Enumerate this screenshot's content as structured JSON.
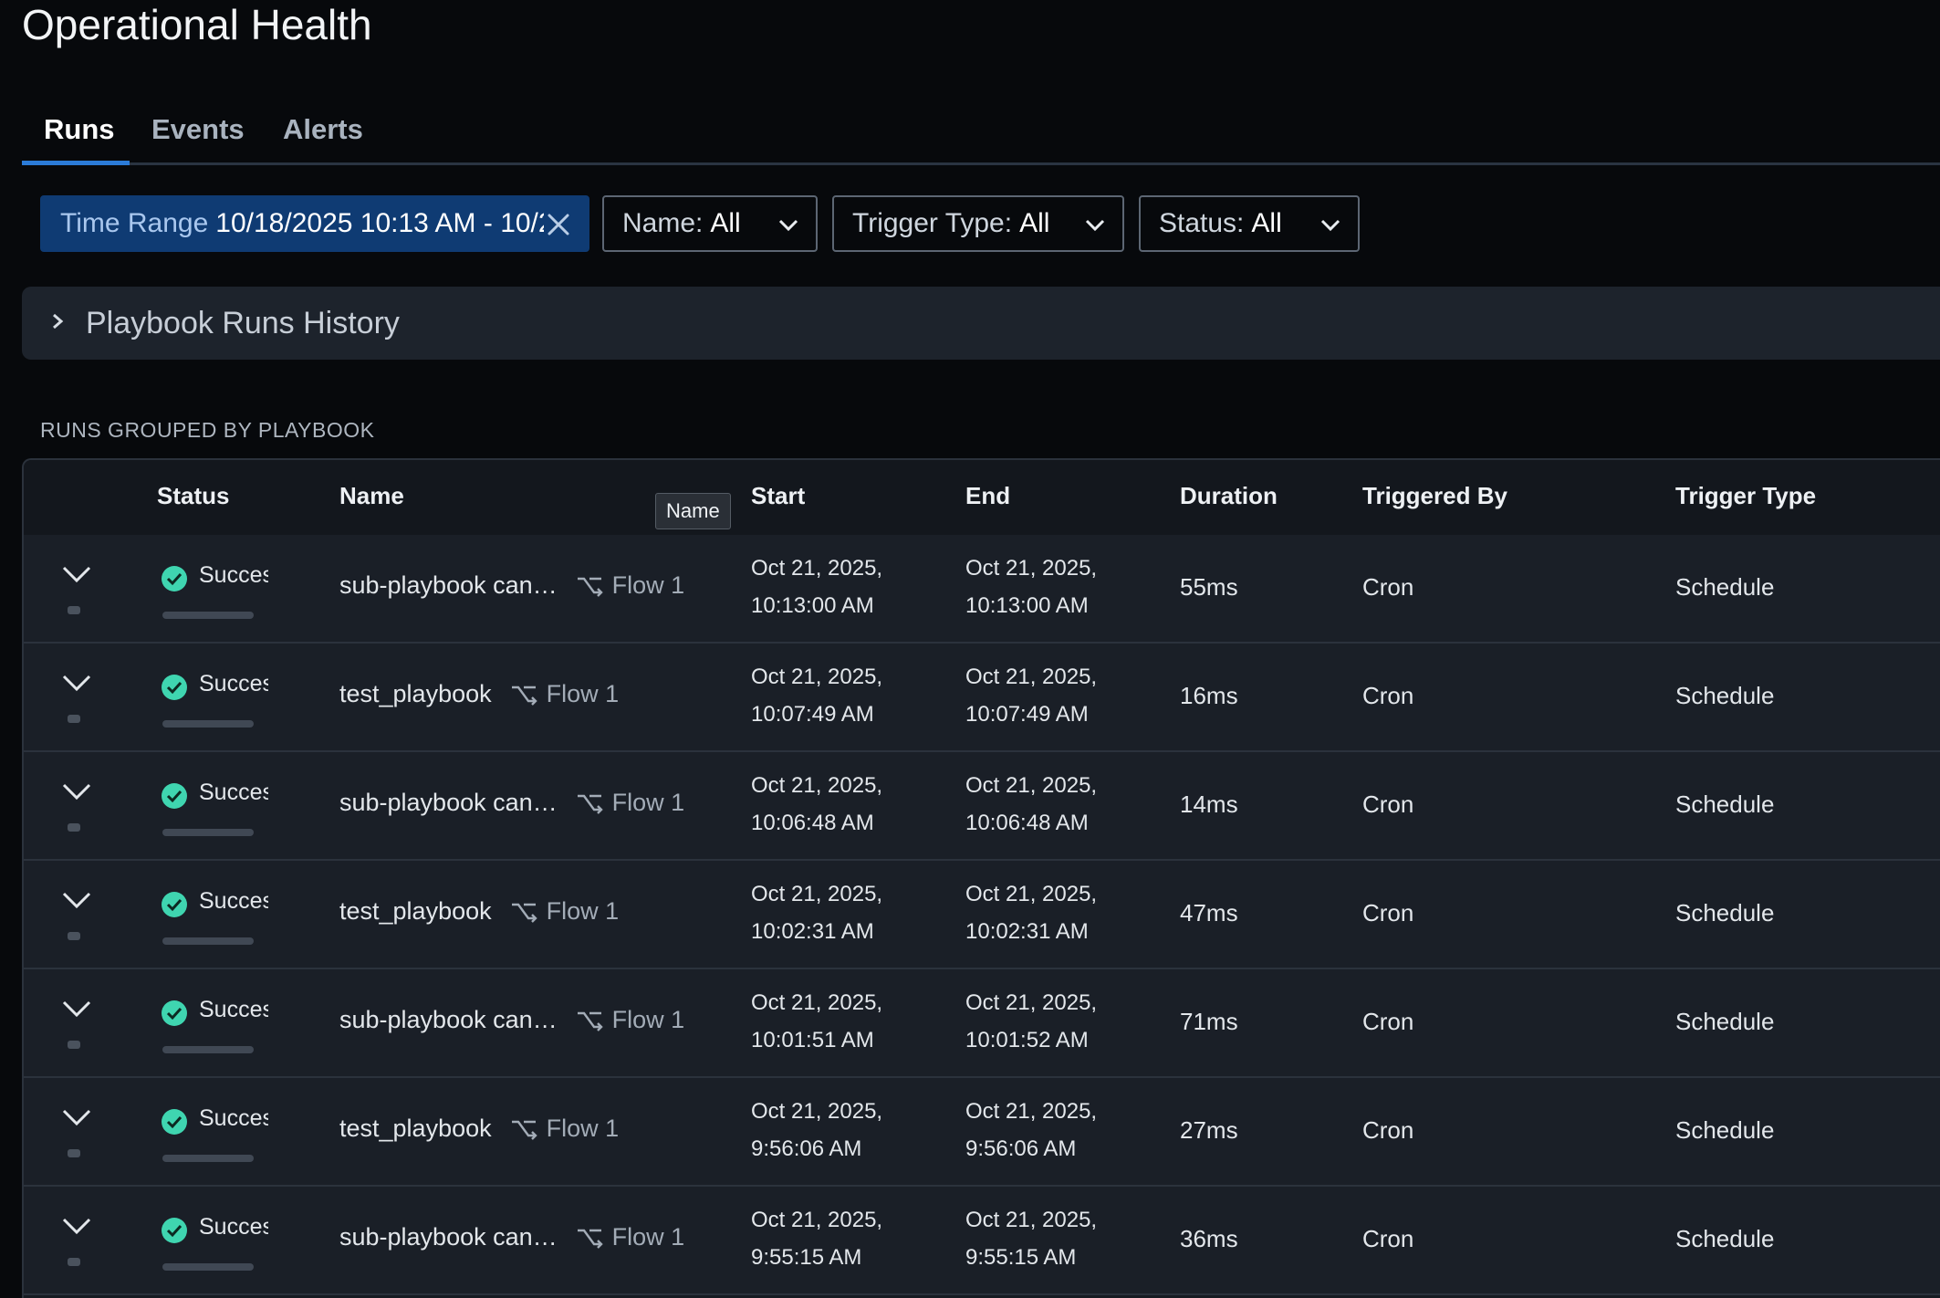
{
  "page": {
    "title": "Operational Health"
  },
  "tabs": [
    {
      "label": "Runs"
    },
    {
      "label": "Events"
    },
    {
      "label": "Alerts"
    }
  ],
  "filters": {
    "time_range": {
      "label": "Time Range",
      "value": "10/18/2025 10:13 AM - 10/2"
    },
    "name": {
      "label": "Name:",
      "value": "All"
    },
    "trigger_type": {
      "label": "Trigger Type:",
      "value": "All"
    },
    "status": {
      "label": "Status:",
      "value": "All"
    }
  },
  "history": {
    "label": "Playbook Runs History"
  },
  "section_label": "RUNS GROUPED BY PLAYBOOK",
  "table": {
    "headers": {
      "status": "Status",
      "name": "Name",
      "start": "Start",
      "end": "End",
      "duration": "Duration",
      "triggered_by": "Triggered By",
      "trigger_type": "Trigger Type"
    },
    "tooltip": "Name",
    "rows": [
      {
        "status": "Succes",
        "name": "sub-playbook can…",
        "flow": "Flow 1",
        "start_date": "Oct 21, 2025,",
        "start_time": "10:13:00 AM",
        "end_date": "Oct 21, 2025,",
        "end_time": "10:13:00 AM",
        "duration": "55ms",
        "triggered_by": "Cron",
        "trigger_type": "Schedule"
      },
      {
        "status": "Succes",
        "name": "test_playbook",
        "flow": "Flow 1",
        "start_date": "Oct 21, 2025,",
        "start_time": "10:07:49 AM",
        "end_date": "Oct 21, 2025,",
        "end_time": "10:07:49 AM",
        "duration": "16ms",
        "triggered_by": "Cron",
        "trigger_type": "Schedule"
      },
      {
        "status": "Succes",
        "name": "sub-playbook can…",
        "flow": "Flow 1",
        "start_date": "Oct 21, 2025,",
        "start_time": "10:06:48 AM",
        "end_date": "Oct 21, 2025,",
        "end_time": "10:06:48 AM",
        "duration": "14ms",
        "triggered_by": "Cron",
        "trigger_type": "Schedule"
      },
      {
        "status": "Succes",
        "name": "test_playbook",
        "flow": "Flow 1",
        "start_date": "Oct 21, 2025,",
        "start_time": "10:02:31 AM",
        "end_date": "Oct 21, 2025,",
        "end_time": "10:02:31 AM",
        "duration": "47ms",
        "triggered_by": "Cron",
        "trigger_type": "Schedule"
      },
      {
        "status": "Succes",
        "name": "sub-playbook can…",
        "flow": "Flow 1",
        "start_date": "Oct 21, 2025,",
        "start_time": "10:01:51 AM",
        "end_date": "Oct 21, 2025,",
        "end_time": "10:01:52 AM",
        "duration": "71ms",
        "triggered_by": "Cron",
        "trigger_type": "Schedule"
      },
      {
        "status": "Succes",
        "name": "test_playbook",
        "flow": "Flow 1",
        "start_date": "Oct 21, 2025,",
        "start_time": "9:56:06 AM",
        "end_date": "Oct 21, 2025,",
        "end_time": "9:56:06 AM",
        "duration": "27ms",
        "triggered_by": "Cron",
        "trigger_type": "Schedule"
      },
      {
        "status": "Succes",
        "name": "sub-playbook can…",
        "flow": "Flow 1",
        "start_date": "Oct 21, 2025,",
        "start_time": "9:55:15 AM",
        "end_date": "Oct 21, 2025,",
        "end_time": "9:55:15 AM",
        "duration": "36ms",
        "triggered_by": "Cron",
        "trigger_type": "Schedule"
      }
    ]
  },
  "colors": {
    "accent": "#2b7bd8",
    "time_chip_bg": "#0f3b73",
    "success": "#3fd5b0"
  }
}
